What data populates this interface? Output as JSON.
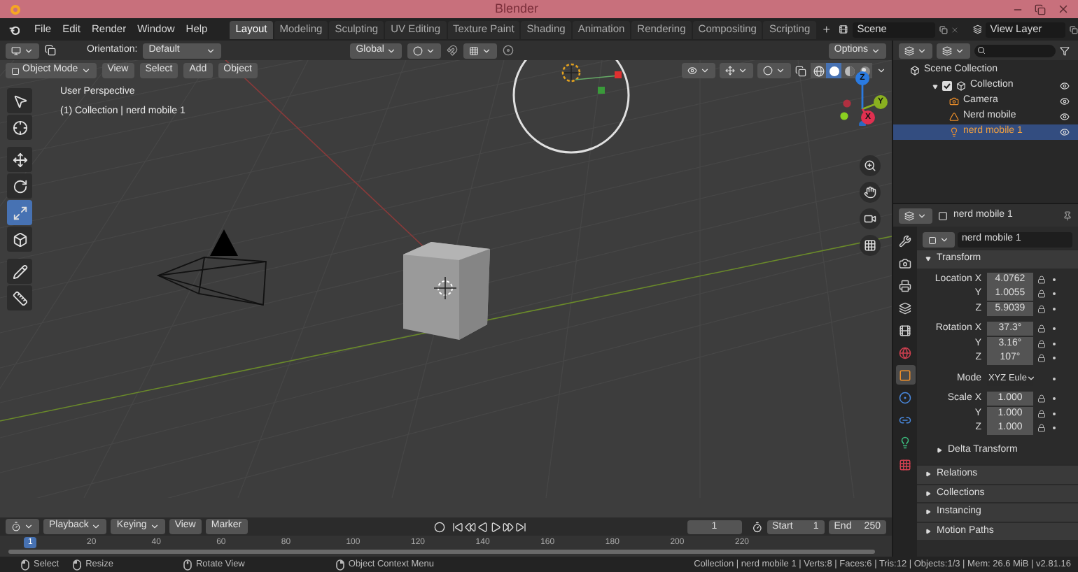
{
  "window": {
    "title": "Blender"
  },
  "menu": [
    "File",
    "Edit",
    "Render",
    "Window",
    "Help"
  ],
  "workspaces": [
    {
      "label": "Layout",
      "selected": true
    },
    {
      "label": "Modeling",
      "selected": false
    },
    {
      "label": "Sculpting",
      "selected": false
    },
    {
      "label": "UV Editing",
      "selected": false
    },
    {
      "label": "Texture Paint",
      "selected": false
    },
    {
      "label": "Shading",
      "selected": false
    },
    {
      "label": "Animation",
      "selected": false
    },
    {
      "label": "Rendering",
      "selected": false
    },
    {
      "label": "Compositing",
      "selected": false
    },
    {
      "label": "Scripting",
      "selected": false
    }
  ],
  "scene": {
    "value": "Scene"
  },
  "view_layer": {
    "value": "View Layer"
  },
  "viewport_header": {
    "orientation_label": "Orientation:",
    "orientation": "Default",
    "transform_orientation": "Global",
    "options": "Options",
    "mode": "Object Mode",
    "menus": [
      "View",
      "Select",
      "Add",
      "Object"
    ],
    "shading": [
      {
        "kind": "wire",
        "selected": false
      },
      {
        "kind": "solid",
        "selected": true
      },
      {
        "kind": "material",
        "selected": false
      },
      {
        "kind": "rendered",
        "selected": false
      }
    ]
  },
  "viewport": {
    "view_name": "User Perspective",
    "context": "(1) Collection | nerd mobile 1",
    "axes": [
      "X",
      "Y",
      "Z"
    ],
    "tools": [
      {
        "kind": "select",
        "selected": false
      },
      {
        "kind": "cursor",
        "selected": false
      },
      {
        "kind": "move",
        "selected": false
      },
      {
        "kind": "rotate",
        "selected": false
      },
      {
        "kind": "scale",
        "selected": true
      },
      {
        "kind": "transform",
        "selected": false
      },
      {
        "kind": "annotate",
        "selected": false
      },
      {
        "kind": "measure",
        "selected": false
      }
    ]
  },
  "outliner": {
    "root": "Scene Collection",
    "collections": [
      {
        "label": "Collection",
        "expanded": true,
        "checked": true,
        "children": [
          {
            "label": "Camera",
            "kind": "camera",
            "selected": false
          },
          {
            "label": "Nerd mobile",
            "kind": "mesh",
            "selected": false
          },
          {
            "label": "nerd mobile 1",
            "kind": "light",
            "selected": true
          }
        ]
      }
    ]
  },
  "properties": {
    "object_name": "nerd mobile 1",
    "datablock": "nerd mobile 1",
    "tabs": [
      {
        "kind": "tool",
        "selected": false
      },
      {
        "kind": "render",
        "selected": false
      },
      {
        "kind": "output",
        "selected": false
      },
      {
        "kind": "view_layer",
        "selected": false
      },
      {
        "kind": "scene",
        "selected": false
      },
      {
        "kind": "world",
        "selected": false
      },
      {
        "kind": "object",
        "selected": true
      },
      {
        "kind": "physics",
        "selected": false
      },
      {
        "kind": "constraints",
        "selected": false
      },
      {
        "kind": "data",
        "selected": false
      },
      {
        "kind": "texture",
        "selected": false
      }
    ],
    "transform": {
      "title": "Transform",
      "expanded": true,
      "sections": [
        {
          "kind": "vector",
          "rows": [
            {
              "label": "Location X",
              "value": "4.0762"
            },
            {
              "label": "Y",
              "value": "1.0055"
            },
            {
              "label": "Z",
              "value": "5.9039"
            }
          ]
        },
        {
          "kind": "vector",
          "rows": [
            {
              "label": "Rotation X",
              "value": "37.3°"
            },
            {
              "label": "Y",
              "value": "3.16°"
            },
            {
              "label": "Z",
              "value": "107°"
            }
          ]
        },
        {
          "kind": "dropdown",
          "label": "Mode",
          "value": "XYZ Eule"
        },
        {
          "kind": "vector",
          "rows": [
            {
              "label": "Scale X",
              "value": "1.000"
            },
            {
              "label": "Y",
              "value": "1.000"
            },
            {
              "label": "Z",
              "value": "1.000"
            }
          ]
        }
      ],
      "subpanels": [
        {
          "title": "Delta Transform",
          "expanded": false
        }
      ]
    },
    "panels": [
      {
        "title": "Relations",
        "expanded": false
      },
      {
        "title": "Collections",
        "expanded": false
      },
      {
        "title": "Instancing",
        "expanded": false
      },
      {
        "title": "Motion Paths",
        "expanded": false
      }
    ]
  },
  "timeline": {
    "menus": [
      "Playback",
      "Keying",
      "View",
      "Marker"
    ],
    "current_frame": "1",
    "start_label": "Start",
    "start": "1",
    "end_label": "End",
    "end": "250",
    "playhead": "1",
    "ticks": [
      "20",
      "40",
      "60",
      "80",
      "100",
      "120",
      "140",
      "160",
      "180",
      "200",
      "220"
    ]
  },
  "status_bar": {
    "hints": [
      {
        "kind": "left",
        "label": "Select"
      },
      {
        "kind": "drag",
        "label": "Resize"
      },
      {
        "kind": "middle",
        "label": "Rotate View"
      },
      {
        "kind": "right",
        "label": "Object Context Menu"
      }
    ],
    "stats": "Collection | nerd mobile 1 | Verts:8 | Faces:6 | Tris:12 | Objects:1/3 | Mem: 26.6 MiB | v2.81.16"
  }
}
